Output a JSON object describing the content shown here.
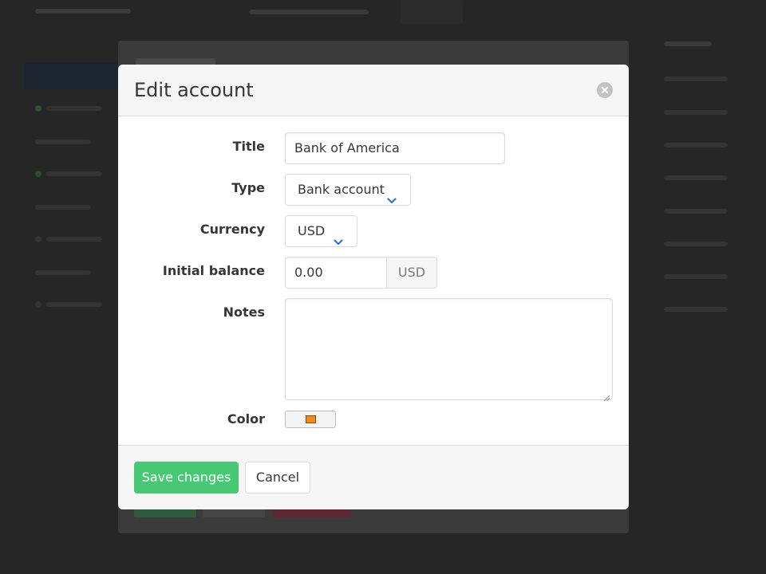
{
  "modal": {
    "title": "Edit account",
    "close_icon": "close-circle-icon",
    "fields": {
      "title": {
        "label": "Title",
        "value": "Bank of America"
      },
      "type": {
        "label": "Type",
        "value": "Bank account",
        "icon": "chevron-down-icon"
      },
      "currency": {
        "label": "Currency",
        "value": "USD",
        "icon": "chevron-down-icon"
      },
      "initial_balance": {
        "label": "Initial balance",
        "value": "0.00",
        "addon": "USD"
      },
      "notes": {
        "label": "Notes",
        "value": ""
      },
      "color": {
        "label": "Color",
        "value": "#f08a1c"
      }
    },
    "footer": {
      "save_label": "Save changes",
      "cancel_label": "Cancel"
    }
  },
  "colors": {
    "primary": "#48c774",
    "chevron": "#3273dc",
    "overlay": "#0a0a0a"
  }
}
